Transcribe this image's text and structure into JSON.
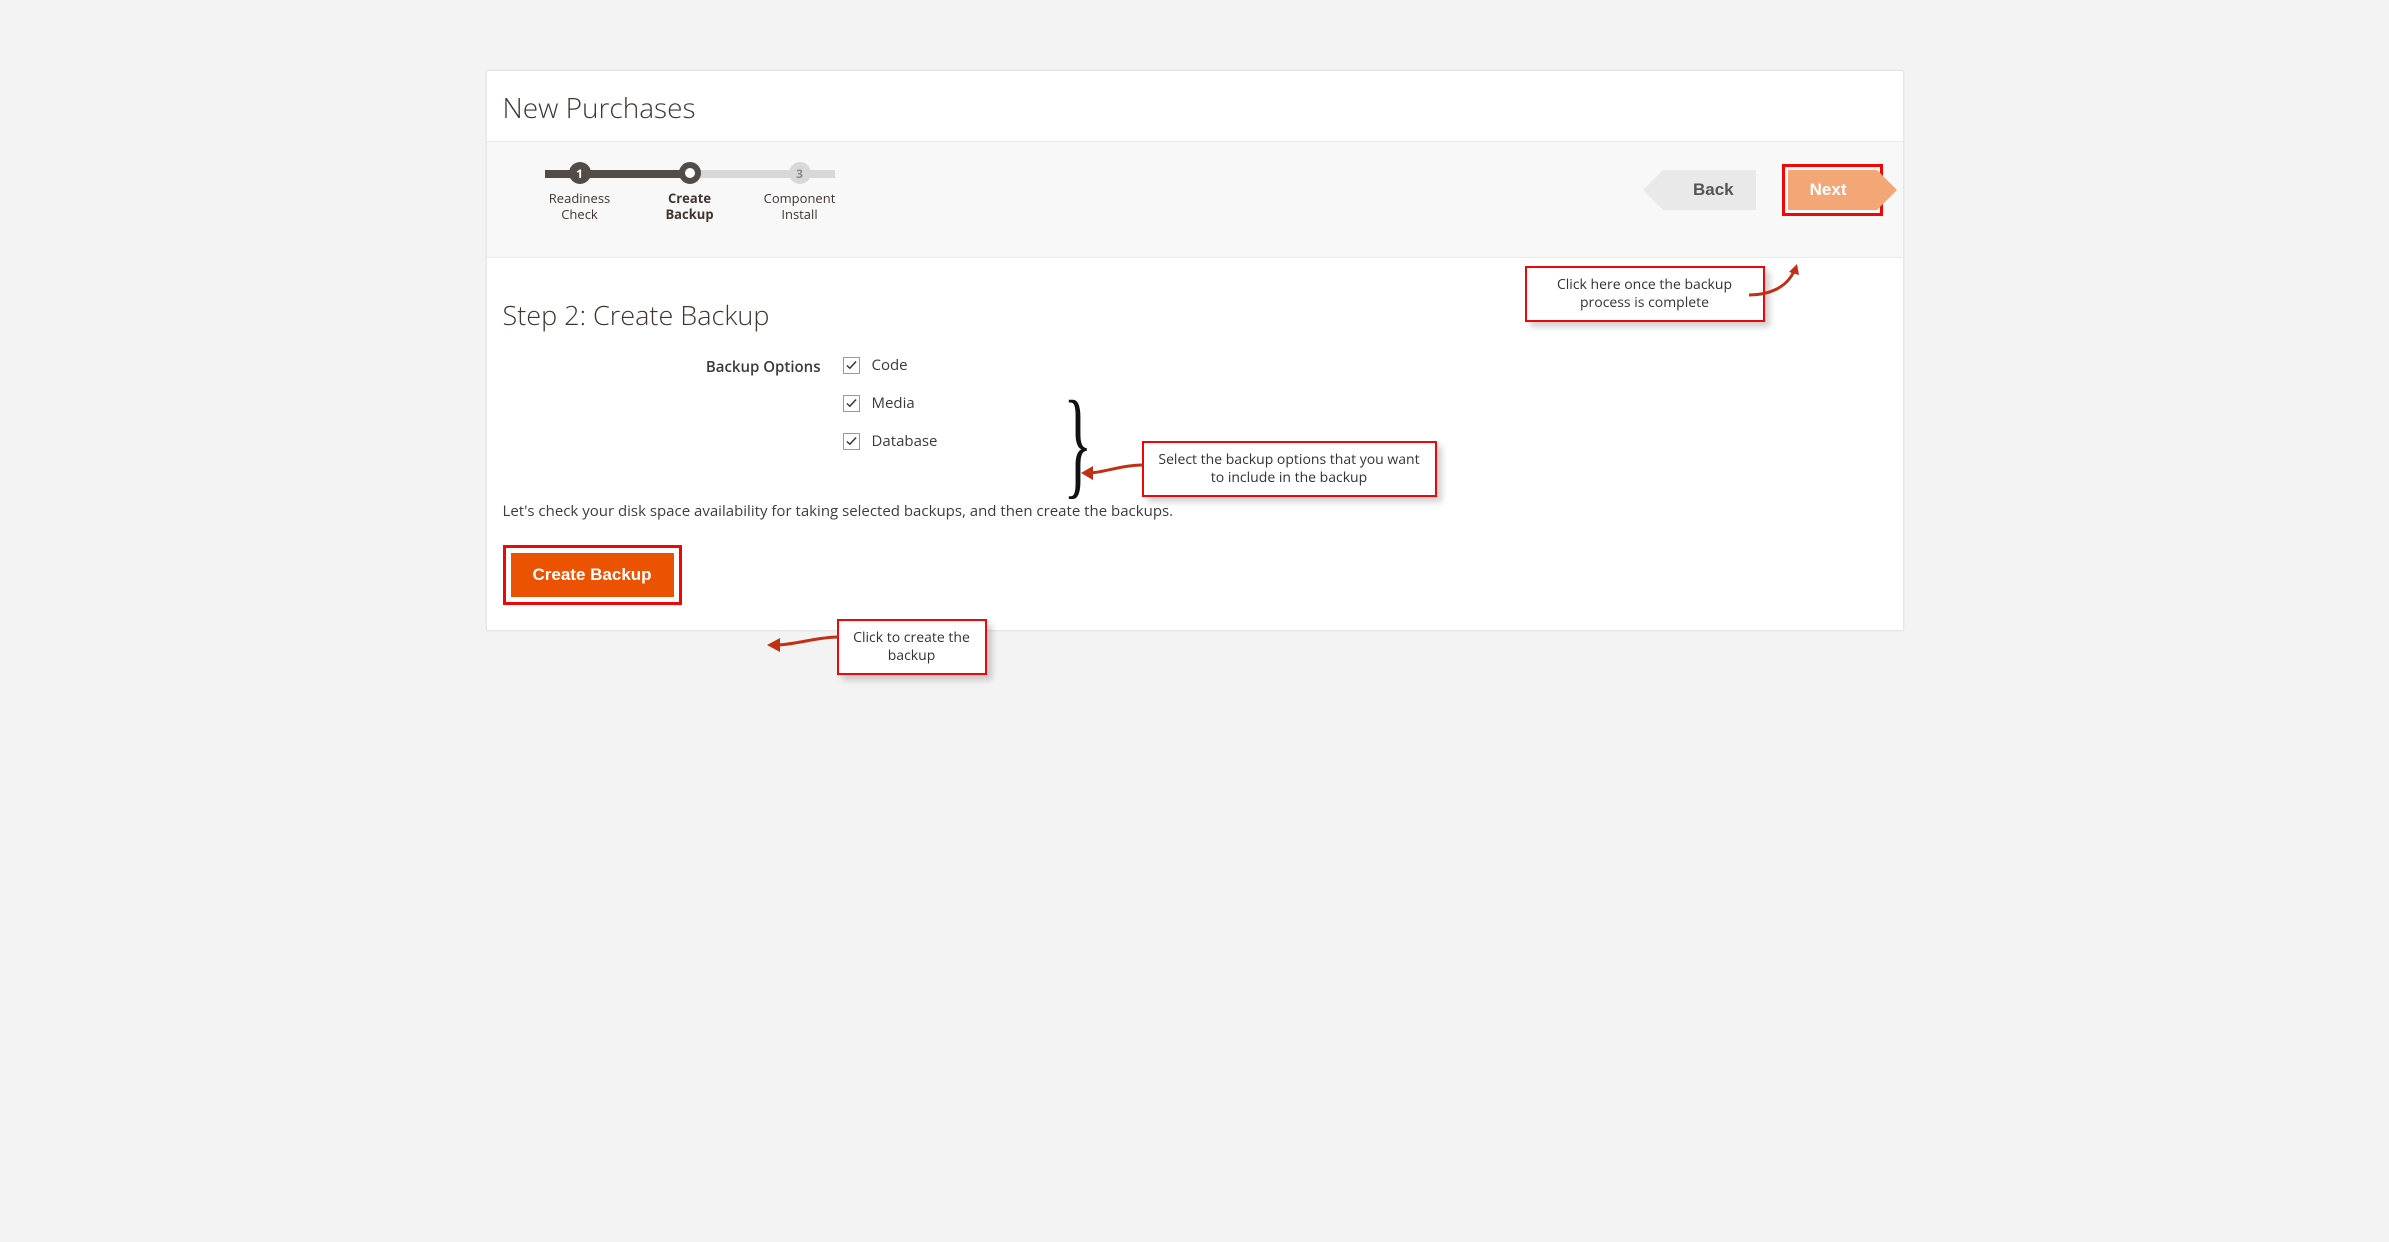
{
  "page_title": "New Purchases",
  "stepper": {
    "steps": [
      {
        "num": "1",
        "label": "Readiness Check",
        "state": "done"
      },
      {
        "num": "",
        "label": "Create Backup",
        "state": "current"
      },
      {
        "num": "3",
        "label": "Component Install",
        "state": "future"
      }
    ]
  },
  "nav": {
    "back_label": "Back",
    "next_label": "Next"
  },
  "step_heading": "Step 2: Create Backup",
  "backup_options_label": "Backup Options",
  "backup_options": [
    {
      "label": "Code",
      "checked": true
    },
    {
      "label": "Media",
      "checked": true
    },
    {
      "label": "Database",
      "checked": true
    }
  ],
  "description": "Let's check your disk space availability for taking selected backups, and then create the backups.",
  "create_button_label": "Create Backup",
  "callouts": {
    "next": "Click here once the backup process is complete",
    "opts": "Select the backup options that you want to include in the backup",
    "create": "Click to create the backup"
  },
  "colors": {
    "accent": "#eb5202",
    "callout_border": "#ef0707"
  }
}
